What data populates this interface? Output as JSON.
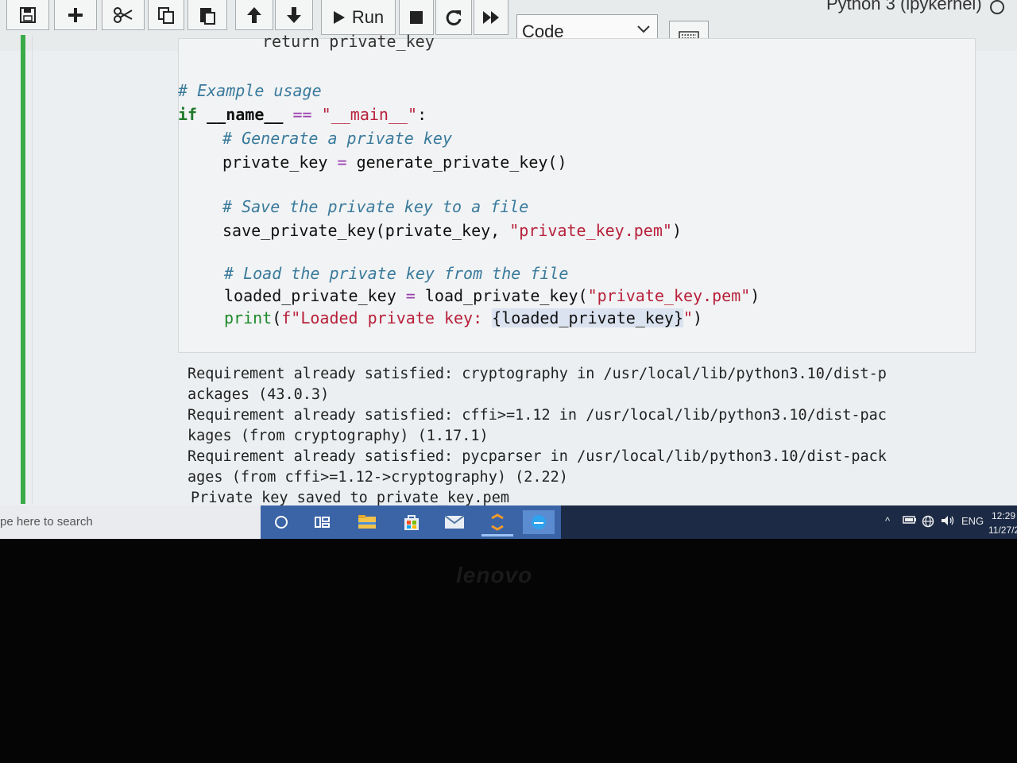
{
  "toolbar": {
    "buttons": [
      "save-icon",
      "add-icon",
      "cut-icon",
      "copy-icon",
      "paste-icon",
      "move-up-icon",
      "move-down-icon"
    ],
    "run_label": "Run",
    "cell_type": "Code",
    "kernel_name": "Python 3 (ipykernel)"
  },
  "code": {
    "partial_line": "return private_key",
    "comment_example": "# Example usage",
    "if_kw": "if",
    "name_var": "__name__",
    "eq_op": "==",
    "main_str": "\"__main__\"",
    "colon": ":",
    "comment_generate": "# Generate a private key",
    "gen_lhs": "private_key ",
    "gen_op": "=",
    "gen_rhs": " generate_private_key()",
    "comment_save": "# Save the private key to a file",
    "save_call": "save_private_key(private_key, ",
    "save_str": "\"private_key.pem\"",
    "save_close": ")",
    "comment_load": "# Load the private key from the file",
    "load_lhs": "loaded_private_key ",
    "load_op": "=",
    "load_call": " load_private_key(",
    "load_str": "\"private_key.pem\"",
    "load_close": ")",
    "print_fn": "print",
    "print_open": "(",
    "print_fstr": "f\"Loaded private key: ",
    "print_expr": "{loaded_private_key}",
    "print_end_str": "\"",
    "print_close": ")"
  },
  "output": {
    "lines": [
      "Requirement already satisfied: cryptography in /usr/local/lib/python3.10/dist-p",
      "ackages (43.0.3)",
      "Requirement already satisfied: cffi>=1.12 in /usr/local/lib/python3.10/dist-pac",
      "kages (from cryptography) (1.17.1)",
      "Requirement already satisfied: pycparser in /usr/local/lib/python3.10/dist-pack",
      "ages (from cffi>=1.12->cryptography) (2.22)",
      "Private key saved to private_key.pem"
    ]
  },
  "taskbar": {
    "search_placeholder": "pe here to search",
    "apps": [
      "cortana-icon",
      "task-view-icon",
      "file-explorer-icon",
      "store-icon",
      "mail-icon",
      "app-icon",
      "edge-icon"
    ],
    "language": "ENG",
    "time": "12:29",
    "date": "11/27/2"
  },
  "bezel_brand": "lenovo"
}
